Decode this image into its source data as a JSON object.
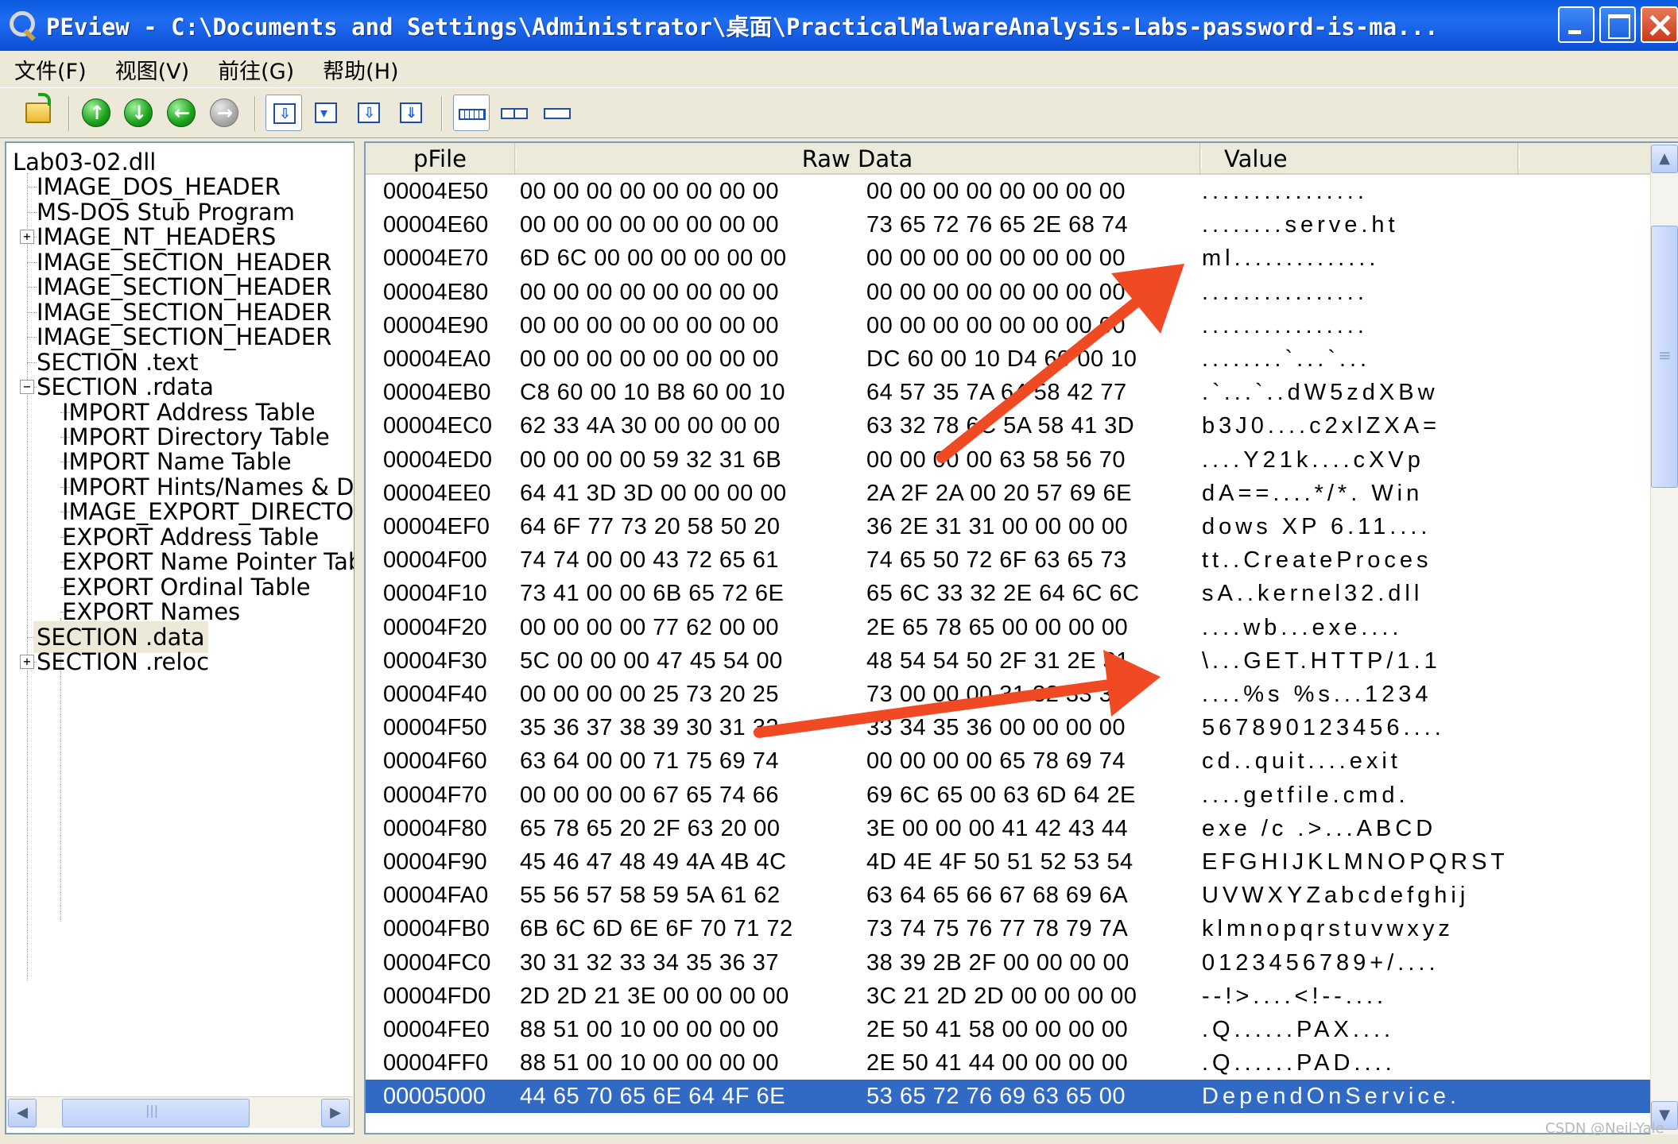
{
  "window": {
    "title": "PEview - C:\\Documents and Settings\\Administrator\\桌面\\PracticalMalwareAnalysis-Labs-password-is-ma..."
  },
  "menu": [
    {
      "label": "文件(F)"
    },
    {
      "label": "视图(V)"
    },
    {
      "label": "前往(G)"
    },
    {
      "label": "帮助(H)"
    }
  ],
  "toolbar_icons": [
    "open-file-icon",
    "up-arrow-icon",
    "down-arrow-icon",
    "back-arrow-icon",
    "forward-arrow-icon",
    "view-hex-icon",
    "view-header-icon",
    "view-save-icon",
    "view-download-icon",
    "byte-width-icon",
    "word-width-icon",
    "dword-width-icon"
  ],
  "tree": {
    "root": "Lab03-02.dll",
    "items": [
      {
        "label": "IMAGE_DOS_HEADER",
        "level": 1
      },
      {
        "label": "MS-DOS Stub Program",
        "level": 1
      },
      {
        "label": "IMAGE_NT_HEADERS",
        "level": 1,
        "expander": "+"
      },
      {
        "label": "IMAGE_SECTION_HEADER",
        "level": 1
      },
      {
        "label": "IMAGE_SECTION_HEADER",
        "level": 1
      },
      {
        "label": "IMAGE_SECTION_HEADER",
        "level": 1
      },
      {
        "label": "IMAGE_SECTION_HEADER",
        "level": 1
      },
      {
        "label": "SECTION .text",
        "level": 1
      },
      {
        "label": "SECTION .rdata",
        "level": 1,
        "expander": "−"
      },
      {
        "label": "IMPORT Address Table",
        "level": 2
      },
      {
        "label": "IMPORT Directory Table",
        "level": 2
      },
      {
        "label": "IMPORT Name Table",
        "level": 2
      },
      {
        "label": "IMPORT Hints/Names & DLL Names",
        "level": 2
      },
      {
        "label": "IMAGE_EXPORT_DIRECTORY",
        "level": 2
      },
      {
        "label": "EXPORT Address Table",
        "level": 2
      },
      {
        "label": "EXPORT Name Pointer Table",
        "level": 2
      },
      {
        "label": "EXPORT Ordinal Table",
        "level": 2
      },
      {
        "label": "EXPORT Names",
        "level": 2
      },
      {
        "label": "SECTION .data",
        "level": 1,
        "selected": true
      },
      {
        "label": "SECTION .reloc",
        "level": 1,
        "expander": "+"
      }
    ]
  },
  "columns": {
    "pfile": "pFile",
    "raw": "Raw Data",
    "value": "Value"
  },
  "rows": [
    {
      "off": "00004E50",
      "r1": "00 00 00 00 00 00 00 00",
      "r2": "00 00 00 00 00 00 00 00",
      "val": "................"
    },
    {
      "off": "00004E60",
      "r1": "00 00 00 00 00 00 00 00",
      "r2": "73 65 72 76 65 2E 68 74",
      "val": "........serve.ht"
    },
    {
      "off": "00004E70",
      "r1": "6D 6C 00 00 00 00 00 00",
      "r2": "00 00 00 00 00 00 00 00",
      "val": "ml.............."
    },
    {
      "off": "00004E80",
      "r1": "00 00 00 00 00 00 00 00",
      "r2": "00 00 00 00 00 00 00 00",
      "val": "................"
    },
    {
      "off": "00004E90",
      "r1": "00 00 00 00 00 00 00 00",
      "r2": "00 00 00 00 00 00 00 00",
      "val": "................"
    },
    {
      "off": "00004EA0",
      "r1": "00 00 00 00 00 00 00 00",
      "r2": "DC 60 00 10 D4 60 00 10",
      "val": "........`...`..."
    },
    {
      "off": "00004EB0",
      "r1": "C8 60 00 10 B8 60 00 10",
      "r2": "64 57 35 7A 64 58 42 77",
      "val": ".`...`..dW5zdXBw"
    },
    {
      "off": "00004EC0",
      "r1": "62 33 4A 30 00 00 00 00",
      "r2": "63 32 78 6C 5A 58 41 3D",
      "val": "b3J0....c2xlZXA="
    },
    {
      "off": "00004ED0",
      "r1": "00 00 00 00 59 32 31 6B",
      "r2": "00 00 00 00 63 58 56 70",
      "val": "....Y21k....cXVp"
    },
    {
      "off": "00004EE0",
      "r1": "64 41 3D 3D 00 00 00 00",
      "r2": "2A 2F 2A 00 20 57 69 6E",
      "val": "dA==....*/*. Win"
    },
    {
      "off": "00004EF0",
      "r1": "64 6F 77 73 20 58 50 20",
      "r2": "36 2E 31 31 00 00 00 00",
      "val": "dows XP 6.11...."
    },
    {
      "off": "00004F00",
      "r1": "74 74 00 00 43 72 65 61",
      "r2": "74 65 50 72 6F 63 65 73",
      "val": "tt..CreateProces"
    },
    {
      "off": "00004F10",
      "r1": "73 41 00 00 6B 65 72 6E",
      "r2": "65 6C 33 32 2E 64 6C 6C",
      "val": "sA..kernel32.dll"
    },
    {
      "off": "00004F20",
      "r1": "00 00 00 00 77 62 00 00",
      "r2": "2E 65 78 65 00 00 00 00",
      "val": "....wb...exe...."
    },
    {
      "off": "00004F30",
      "r1": "5C 00 00 00 47 45 54 00",
      "r2": "48 54 54 50 2F 31 2E 31",
      "val": "\\...GET.HTTP/1.1"
    },
    {
      "off": "00004F40",
      "r1": "00 00 00 00 25 73 20 25",
      "r2": "73 00 00 00 31 32 33 34",
      "val": "....%s %s...1234"
    },
    {
      "off": "00004F50",
      "r1": "35 36 37 38 39 30 31 32",
      "r2": "33 34 35 36 00 00 00 00",
      "val": "567890123456...."
    },
    {
      "off": "00004F60",
      "r1": "63 64 00 00 71 75 69 74",
      "r2": "00 00 00 00 65 78 69 74",
      "val": "cd..quit....exit"
    },
    {
      "off": "00004F70",
      "r1": "00 00 00 00 67 65 74 66",
      "r2": "69 6C 65 00 63 6D 64 2E",
      "val": "....getfile.cmd."
    },
    {
      "off": "00004F80",
      "r1": "65 78 65 20 2F 63 20 00",
      "r2": "3E 00 00 00 41 42 43 44",
      "val": "exe /c .>...ABCD"
    },
    {
      "off": "00004F90",
      "r1": "45 46 47 48 49 4A 4B 4C",
      "r2": "4D 4E 4F 50 51 52 53 54",
      "val": "EFGHIJKLMNOPQRST"
    },
    {
      "off": "00004FA0",
      "r1": "55 56 57 58 59 5A 61 62",
      "r2": "63 64 65 66 67 68 69 6A",
      "val": "UVWXYZabcdefghij"
    },
    {
      "off": "00004FB0",
      "r1": "6B 6C 6D 6E 6F 70 71 72",
      "r2": "73 74 75 76 77 78 79 7A",
      "val": "klmnopqrstuvwxyz"
    },
    {
      "off": "00004FC0",
      "r1": "30 31 32 33 34 35 36 37",
      "r2": "38 39 2B 2F 00 00 00 00",
      "val": "0123456789+/...."
    },
    {
      "off": "00004FD0",
      "r1": "2D 2D 21 3E 00 00 00 00",
      "r2": "3C 21 2D 2D 00 00 00 00",
      "val": "--!>....<!--...."
    },
    {
      "off": "00004FE0",
      "r1": "88 51 00 10 00 00 00 00",
      "r2": "2E 50 41 58 00 00 00 00",
      "val": ".Q......PAX...."
    },
    {
      "off": "00004FF0",
      "r1": "88 51 00 10 00 00 00 00",
      "r2": "2E 50 41 44 00 00 00 00",
      "val": ".Q......PAD...."
    },
    {
      "off": "00005000",
      "r1": "44 65 70 65 6E 64 4F 6E",
      "r2": "53 65 72 76 69 63 65 00",
      "val": "DependOnService.",
      "highlight": true
    }
  ],
  "watermark": "CSDN @Neil-Yale",
  "colors": {
    "titlebar": "#0b4fd4",
    "selection": "#316ac5",
    "annotation_arrow": "#f04a24"
  }
}
